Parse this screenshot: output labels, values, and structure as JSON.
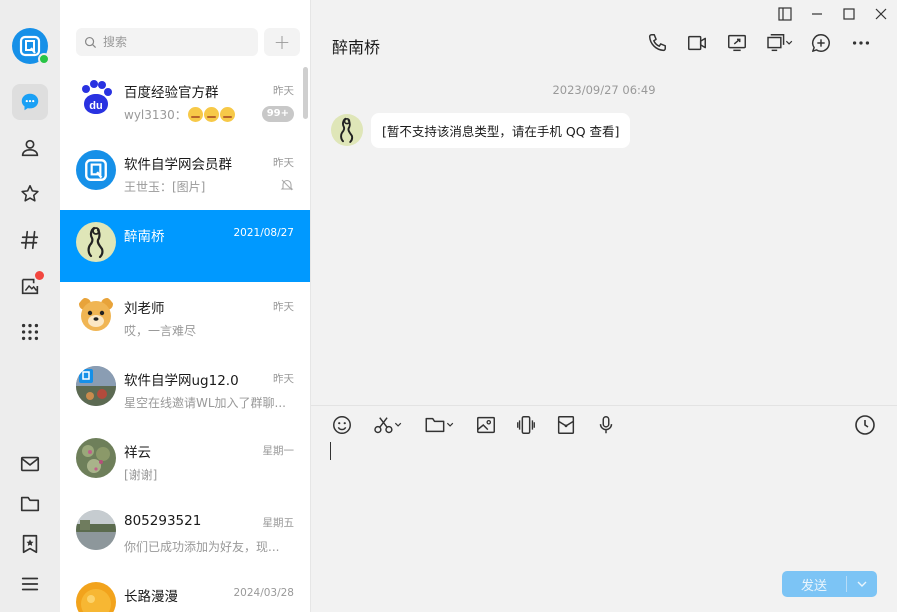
{
  "window": {
    "controls": [
      "sidebar-toggle",
      "minimize",
      "maximize",
      "close"
    ]
  },
  "rail": {
    "items": [
      "chat-icon",
      "contacts-icon",
      "star-icon",
      "channel-icon",
      "moments-icon",
      "apps-icon"
    ],
    "bottom": [
      "mail-icon",
      "folder-icon",
      "bookmark-icon",
      "menu-icon"
    ],
    "online_color": "#28c445",
    "notify_color": "#f2463f"
  },
  "search": {
    "placeholder": "搜索"
  },
  "conversations": [
    {
      "name": "百度经验官方群",
      "time": "昨天",
      "preview": "wyl3130：",
      "badge": "99+",
      "avatar": "baidu-logo"
    },
    {
      "name": "软件自学网会员群",
      "time": "昨天",
      "preview": "王世玉：[图片]",
      "muted": true,
      "avatar": "qq-logo"
    },
    {
      "name": "醉南桥",
      "time": "2021/08/27",
      "preview": "",
      "selected": true,
      "avatar": "ink-figure"
    },
    {
      "name": "刘老师",
      "time": "昨天",
      "preview": "哎，一言难尽",
      "avatar": "cartoon-bear"
    },
    {
      "name": "软件自学网ug12.0",
      "time": "昨天",
      "preview": "星空在线邀请WL加入了群聊...",
      "avatar": "group-photo"
    },
    {
      "name": "祥云",
      "time": "星期一",
      "preview": "[谢谢]",
      "avatar": "flowers-photo"
    },
    {
      "name": "805293521",
      "time": "星期五",
      "preview": "你们已成功添加为好友，现...",
      "avatar": "lake-photo"
    },
    {
      "name": "长路漫漫",
      "time": "2024/03/28",
      "preview": "",
      "avatar": "orange-photo"
    }
  ],
  "chat": {
    "title": "醉南桥",
    "timestamp": "2023/09/27 06:49",
    "message": "[暂不支持该消息类型，请在手机 QQ 查看]",
    "send_label": "发送",
    "accent": "#0099ff"
  }
}
